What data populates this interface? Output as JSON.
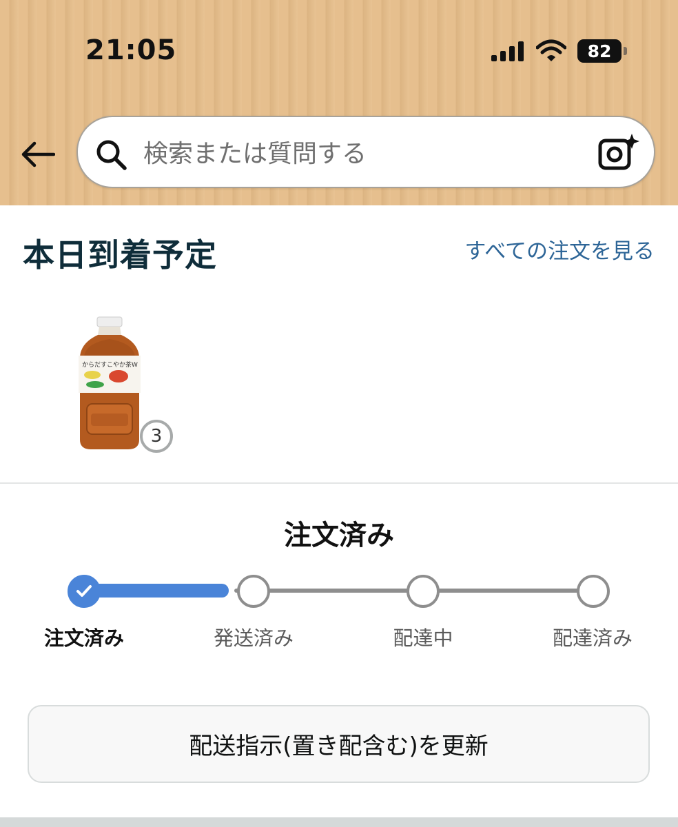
{
  "status_bar": {
    "time": "21:05",
    "battery": "82",
    "icons": [
      "signal-icon",
      "wifi-icon",
      "battery-icon"
    ]
  },
  "header": {
    "back_icon": "back-arrow-icon",
    "search": {
      "placeholder": "検索または質問する",
      "search_icon": "search-icon",
      "camera_icon": "camera-sparkle-icon"
    }
  },
  "arrival": {
    "title": "本日到着予定",
    "view_all_link": "すべての注文を見る",
    "item": {
      "image": "tea-bottle-image",
      "label_text": "からだすこやか茶W",
      "quantity": "3"
    }
  },
  "tracking": {
    "status_title": "注文済み",
    "steps": [
      {
        "label": "注文済み",
        "completed": true
      },
      {
        "label": "発送済み",
        "completed": false
      },
      {
        "label": "配達中",
        "completed": false
      },
      {
        "label": "配達済み",
        "completed": false
      }
    ]
  },
  "actions": {
    "update_button": "配送指示(置き配含む)を更新"
  },
  "colors": {
    "header_bg": "#e6bf8e",
    "progress_blue": "#4a84d8",
    "link_blue": "#2d6597",
    "title_dark": "#0f2d3a"
  }
}
